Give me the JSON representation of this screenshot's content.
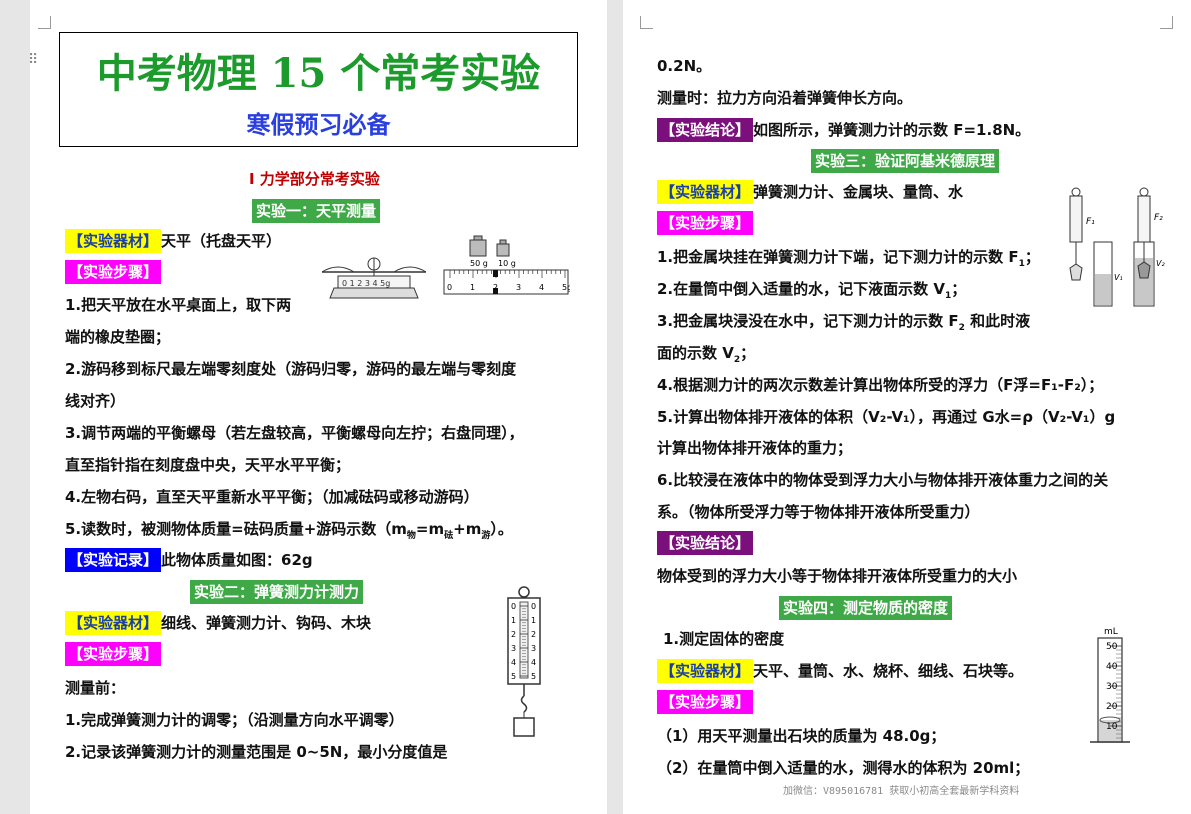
{
  "left": {
    "title": "中考物理 15 个常考实验",
    "subtitle": "寒假预习必备",
    "section_head": "Ⅰ 力学部分常考实验",
    "exp1": {
      "head": "实验一：天平测量",
      "materials_tag": "【实验器材】",
      "materials": "天平（托盘天平）",
      "steps_tag": "【实验步骤】",
      "s1a": "1.把天平放在水平桌面上，取下两",
      "s1b": "端的橡皮垫圈；",
      "s2a": "2.游码移到标尺最左端零刻度处（游码归零，游码的最左端与零刻度",
      "s2b": "线对齐）",
      "s3a": "3.调节两端的平衡螺母（若左盘较高，平衡螺母向左拧；右盘同理），",
      "s3b": "直至指针指在刻度盘中央，天平水平平衡；",
      "s4": "4.左物右码，直至天平重新水平平衡；（加减砝码或移动游码）",
      "s5_pre": "5.读数时，被测物体质量=砝码质量+游码示数（m",
      "s5_sub1": "物",
      "s5_mid1": "=m",
      "s5_sub2": "砝",
      "s5_mid2": "+m",
      "s5_sub3": "游",
      "s5_post": "）。",
      "record_tag": "【实验记录】",
      "record": "此物体质量如图：62g",
      "fig_weight1": "50 g",
      "fig_weight2": "10 g",
      "fig_ticks": [
        "0",
        "1",
        "2",
        "3",
        "4",
        "5g"
      ],
      "fig_balance_scale": "0 1 2 3 4 5g"
    },
    "exp2": {
      "head": "实验二：弹簧测力计测力",
      "materials_tag": "【实验器材】",
      "materials": "细线、弹簧测力计、钩码、木块",
      "steps_tag": "【实验步骤】",
      "before": "测量前：",
      "s1": "1.完成弹簧测力计的调零；（沿测量方向水平调零）",
      "s2": "2.记录该弹簧测力计的测量范围是  0~5N，最小分度值是",
      "fig_ticks": [
        "0",
        "1",
        "2",
        "3",
        "4",
        "5"
      ]
    }
  },
  "right": {
    "cont1": "0.2N。",
    "cont2": "测量时：拉力方向沿着弹簧伸长方向。",
    "conc_tag": "【实验结论】",
    "conc": "如图所示，弹簧测力计的示数  F=1.8N。",
    "exp3": {
      "head": "实验三：验证阿基米德原理",
      "materials_tag": "【实验器材】",
      "materials": "弹簧测力计、金属块、量筒、水",
      "steps_tag": "【实验步骤】",
      "s1_pre": "1.把金属块挂在弹簧测力计下端，记下测力计的示数 F",
      "s1_sub": "1",
      "s1_post": "；",
      "s2_pre": "2.在量筒中倒入适量的水，记下液面示数 V",
      "s2_sub": "1",
      "s2_post": "；",
      "s3a_pre": "3.把金属块浸没在水中，记下测力计的示数 F",
      "s3a_sub": "2",
      "s3a_post": " 和此时液",
      "s3b_pre": "面的示数 V",
      "s3b_sub": "2",
      "s3b_post": "；",
      "s4": "4.根据测力计的两次示数差计算出物体所受的浮力（F浮=F₁-F₂）；",
      "s5a": "5.计算出物体排开液体的体积（V₂-V₁），再通过 G水=ρ（V₂-V₁）g",
      "s5b": "计算出物体排开液体的重力；",
      "s6a": "6.比较浸在液体中的物体受到浮力大小与物体排开液体重力之间的关",
      "s6b": "系。（物体所受浮力等于物体排开液体所受重力）",
      "conc_tag": "【实验结论】",
      "conc": "物体受到的浮力大小等于物体排开液体所受重力的大小",
      "fig_f1": "F₁",
      "fig_f2": "F₂",
      "fig_v1": "V₁",
      "fig_v2": "V₂"
    },
    "exp4": {
      "head": "实验四：测定物质的密度",
      "sub1": "1.测定固体的密度",
      "materials_tag": "【实验器材】",
      "materials": "天平、量筒、水、烧杯、细线、石块等。",
      "steps_tag": "【实验步骤】",
      "s1": "（1）用天平测量出石块的质量为  48.0g；",
      "s2": "（2）在量筒中倒入适量的水，测得水的体积为  20ml；",
      "fig_unit": "mL",
      "fig_ticks": [
        "50",
        "40",
        "30",
        "20",
        "10"
      ]
    },
    "footer": "加微信：V895016781 获取小初高全套最新学科资料"
  }
}
